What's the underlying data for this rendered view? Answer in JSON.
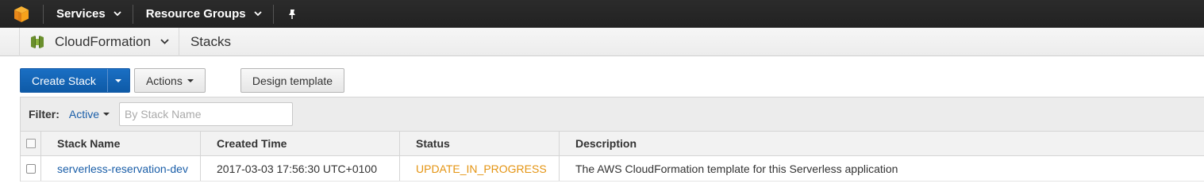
{
  "topnav": {
    "services_label": "Services",
    "resource_groups_label": "Resource Groups"
  },
  "servicebar": {
    "service_name": "CloudFormation",
    "section_title": "Stacks"
  },
  "toolbar": {
    "create_stack_label": "Create Stack",
    "actions_label": "Actions",
    "design_template_label": "Design template"
  },
  "filter": {
    "label": "Filter:",
    "selected": "Active",
    "placeholder": "By Stack Name"
  },
  "table": {
    "columns": [
      "Stack Name",
      "Created Time",
      "Status",
      "Description"
    ],
    "rows": [
      {
        "stack_name": "serverless-reservation-dev",
        "created_time": "2017-03-03 17:56:30 UTC+0100",
        "status": "UPDATE_IN_PROGRESS",
        "description": "The AWS CloudFormation template for this Serverless application"
      }
    ]
  },
  "colors": {
    "primary": "#1a6fc4",
    "link": "#1a5ea8",
    "status_in_progress": "#e49412",
    "nav_bg": "#232323",
    "aws_logo": "#f7a21b"
  },
  "icons": {
    "logo": "aws-cube-icon",
    "pin": "pin-icon",
    "service": "cloudformation-icon"
  }
}
